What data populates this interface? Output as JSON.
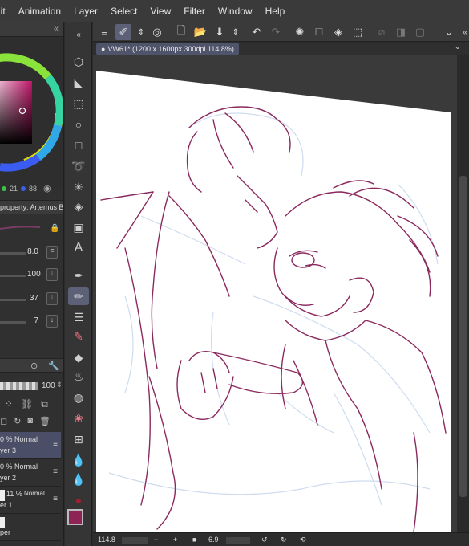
{
  "menubar": {
    "items": [
      "dit",
      "Animation",
      "Layer",
      "Select",
      "View",
      "Filter",
      "Window",
      "Help"
    ]
  },
  "colors": {
    "accent": "#5c6178",
    "main_color": "#8e2356",
    "sub_color": "#ffffff",
    "sketch_line": "#8a2a5e",
    "sketch_blue": "#c9daf0"
  },
  "color_panel": {
    "value_2": "21",
    "value_3": "88"
  },
  "tool_property": {
    "header": "property: Artemus B",
    "rows": [
      {
        "value": "8.0"
      },
      {
        "value": "100"
      },
      {
        "value": "37"
      },
      {
        "value": "7"
      }
    ],
    "opacity": "100"
  },
  "layers": {
    "rows": [
      {
        "pct": "0 %",
        "blend": "Normal",
        "name": "yer 3",
        "selected": true
      },
      {
        "pct": "0 %",
        "blend": "Normal",
        "name": "yer 2",
        "selected": false
      },
      {
        "pct": "11 %",
        "blend": "Normal",
        "name": "er 1",
        "selected": false
      },
      {
        "pct": "",
        "blend": "",
        "name": "per",
        "selected": false
      }
    ]
  },
  "document": {
    "tab_label": "VW61* (1200 x 1600px 300dpi 114.8%)"
  },
  "statusbar": {
    "zoom": "114.8",
    "rotation": "6.9"
  }
}
